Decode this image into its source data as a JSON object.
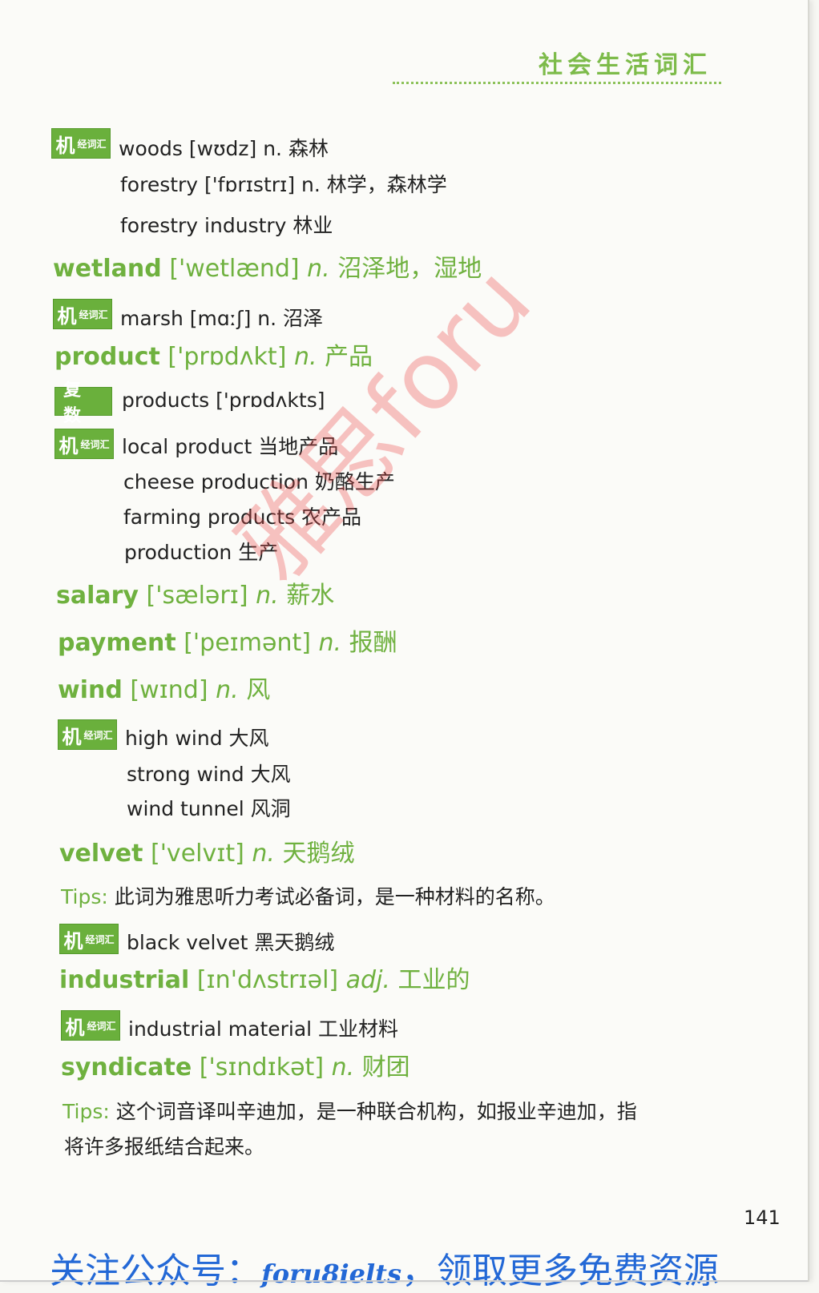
{
  "header": {
    "title": "社会生活词汇"
  },
  "badges": {
    "jijing": {
      "big": "机",
      "small": "经词汇"
    },
    "plural": "复数"
  },
  "entries": {
    "woods_sub": "woods [wʊdz] n. 森林",
    "forestry": "forestry ['fɒrɪstrɪ] n. 林学，森林学",
    "forestry_industry": "forestry industry 林业",
    "wetland": {
      "word": "wetland",
      "ipa": "['wetlænd]",
      "pos": "n.",
      "meaning": "沼泽地，湿地"
    },
    "marsh": "marsh [mɑːʃ] n. 沼泽",
    "product": {
      "word": "product",
      "ipa": "['prɒdʌkt]",
      "pos": "n.",
      "meaning": "产品"
    },
    "products_plural": "products ['prɒdʌkts]",
    "local_product": "local product 当地产品",
    "cheese_production": "cheese production 奶酪生产",
    "farming_products": "farming products 农产品",
    "production": "production 生产",
    "salary": {
      "word": "salary",
      "ipa": "['sælərɪ]",
      "pos": "n.",
      "meaning": "薪水"
    },
    "payment": {
      "word": "payment",
      "ipa": "['peɪmənt]",
      "pos": "n.",
      "meaning": "报酬"
    },
    "wind": {
      "word": "wind",
      "ipa": "[wɪnd]",
      "pos": "n.",
      "meaning": "风"
    },
    "high_wind": "high wind 大风",
    "strong_wind": "strong wind 大风",
    "wind_tunnel": "wind tunnel 风洞",
    "velvet": {
      "word": "velvet",
      "ipa": "['velvɪt]",
      "pos": "n.",
      "meaning": "天鹅绒"
    },
    "velvet_tips": {
      "label": "Tips:",
      "text": "此词为雅思听力考试必备词，是一种材料的名称。"
    },
    "black_velvet": "black velvet 黑天鹅绒",
    "industrial": {
      "word": "industrial",
      "ipa": "[ɪn'dʌstrɪəl]",
      "pos": "adj.",
      "meaning": "工业的"
    },
    "industrial_material": "industrial material 工业材料",
    "syndicate": {
      "word": "syndicate",
      "ipa": "['sɪndɪkət]",
      "pos": "n.",
      "meaning": "财团"
    },
    "syndicate_tips": {
      "label": "Tips:",
      "line1": "这个词音译叫辛迪加，是一种联合机构，如报业辛迪加，指",
      "line2": "将许多报纸结合起来。"
    }
  },
  "page_number": "141",
  "footer": {
    "prefix": "关注公众号：",
    "account": "foru8ielts",
    "suffix": "，领取更多免费资源"
  },
  "watermark": "雅思foru",
  "colors": {
    "accent_green": "#6fb13f",
    "footer_blue": "#2368d6",
    "watermark_red": "#eb4646"
  }
}
